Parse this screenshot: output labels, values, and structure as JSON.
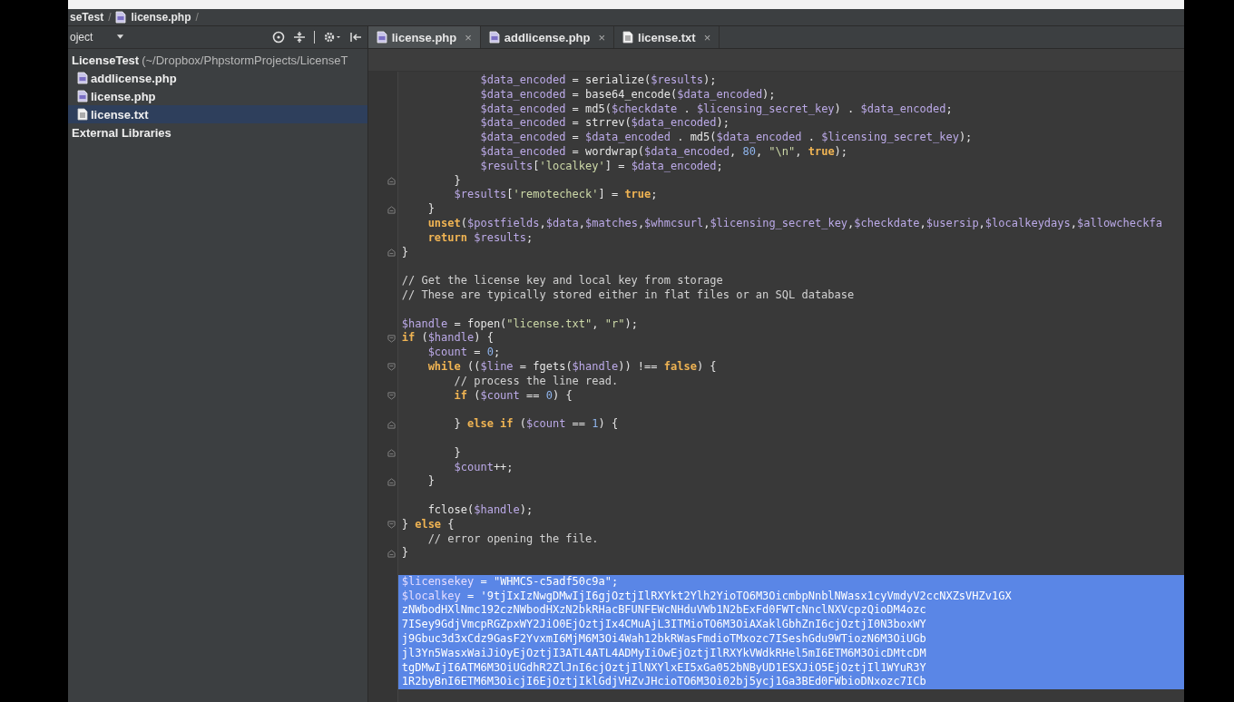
{
  "breadcrumb": [
    "seTest",
    "/",
    "license.php",
    "/"
  ],
  "project_panel": {
    "title": "oject",
    "tree": [
      {
        "name": "LicenseTest",
        "path": "(~/Dropbox/PhpstormProjects/LicenseT",
        "selected": false,
        "children": [
          {
            "name": "addlicense.php",
            "kind": "php",
            "selected": false
          },
          {
            "name": "license.php",
            "kind": "php",
            "selected": false
          },
          {
            "name": "license.txt",
            "kind": "txt",
            "selected": true
          }
        ]
      },
      {
        "name": "External Libraries",
        "selected": false
      }
    ]
  },
  "tabs": [
    {
      "label": "license.php",
      "kind": "php",
      "selected": true,
      "close": "×"
    },
    {
      "label": "addlicense.php",
      "kind": "php",
      "selected": false,
      "close": "×"
    },
    {
      "label": "license.txt",
      "kind": "txt",
      "selected": false,
      "close": "×"
    }
  ],
  "lines": [
    {
      "kind": "code",
      "selected": false,
      "parts": [
        {
          "kind": "var",
          "text": "            $data_encoded"
        },
        {
          "kind": "plain",
          "text": " = serialize("
        },
        {
          "kind": "var",
          "text": "$results"
        },
        {
          "kind": "plain",
          "text": ");"
        }
      ]
    },
    {
      "kind": "code",
      "selected": false,
      "parts": [
        {
          "kind": "var",
          "text": "            $data_encoded"
        },
        {
          "kind": "plain",
          "text": " = base64_encode("
        },
        {
          "kind": "var",
          "text": "$data_encoded"
        },
        {
          "kind": "plain",
          "text": ");"
        }
      ]
    },
    {
      "kind": "code",
      "selected": false,
      "parts": [
        {
          "kind": "var",
          "text": "            $data_encoded"
        },
        {
          "kind": "plain",
          "text": " = md5("
        },
        {
          "kind": "var",
          "text": "$checkdate"
        },
        {
          "kind": "plain",
          "text": " . "
        },
        {
          "kind": "var",
          "text": "$licensing_secret_key"
        },
        {
          "kind": "plain",
          "text": ") . "
        },
        {
          "kind": "var",
          "text": "$data_encoded"
        },
        {
          "kind": "plain",
          "text": ";"
        }
      ]
    },
    {
      "kind": "code",
      "selected": false,
      "parts": [
        {
          "kind": "var",
          "text": "            $data_encoded"
        },
        {
          "kind": "plain",
          "text": " = strrev("
        },
        {
          "kind": "var",
          "text": "$data_encoded"
        },
        {
          "kind": "plain",
          "text": ");"
        }
      ]
    },
    {
      "kind": "code",
      "selected": false,
      "parts": [
        {
          "kind": "var",
          "text": "            $data_encoded"
        },
        {
          "kind": "plain",
          "text": " = "
        },
        {
          "kind": "var",
          "text": "$data_encoded"
        },
        {
          "kind": "plain",
          "text": " . md5("
        },
        {
          "kind": "var",
          "text": "$data_encoded"
        },
        {
          "kind": "plain",
          "text": " . "
        },
        {
          "kind": "var",
          "text": "$licensing_secret_key"
        },
        {
          "kind": "plain",
          "text": ");"
        }
      ]
    },
    {
      "kind": "code",
      "selected": false,
      "parts": [
        {
          "kind": "var",
          "text": "            $data_encoded"
        },
        {
          "kind": "plain",
          "text": " = wordwrap("
        },
        {
          "kind": "var",
          "text": "$data_encoded"
        },
        {
          "kind": "plain",
          "text": ", "
        },
        {
          "kind": "num",
          "text": "80"
        },
        {
          "kind": "plain",
          "text": ", "
        },
        {
          "kind": "str",
          "text": "\"\\n\""
        },
        {
          "kind": "plain",
          "text": ", "
        },
        {
          "kind": "kw",
          "text": "true"
        },
        {
          "kind": "plain",
          "text": ");"
        }
      ]
    },
    {
      "kind": "code",
      "selected": false,
      "parts": [
        {
          "kind": "var",
          "text": "            $results"
        },
        {
          "kind": "plain",
          "text": "["
        },
        {
          "kind": "str",
          "text": "'localkey'"
        },
        {
          "kind": "plain",
          "text": "] = "
        },
        {
          "kind": "var",
          "text": "$data_encoded"
        },
        {
          "kind": "plain",
          "text": ";"
        }
      ]
    },
    {
      "kind": "fold-end",
      "selected": false,
      "parts": [
        {
          "kind": "plain",
          "text": "        }"
        }
      ]
    },
    {
      "kind": "code",
      "selected": false,
      "parts": [
        {
          "kind": "var",
          "text": "        $results"
        },
        {
          "kind": "plain",
          "text": "["
        },
        {
          "kind": "str",
          "text": "'remotecheck'"
        },
        {
          "kind": "plain",
          "text": "] = "
        },
        {
          "kind": "kw",
          "text": "true"
        },
        {
          "kind": "plain",
          "text": ";"
        }
      ]
    },
    {
      "kind": "fold-end",
      "selected": false,
      "parts": [
        {
          "kind": "plain",
          "text": "    }"
        }
      ]
    },
    {
      "kind": "code",
      "selected": false,
      "parts": [
        {
          "kind": "kw",
          "text": "    unset"
        },
        {
          "kind": "plain",
          "text": "("
        },
        {
          "kind": "var",
          "text": "$postfields"
        },
        {
          "kind": "plain",
          "text": ","
        },
        {
          "kind": "var",
          "text": "$data"
        },
        {
          "kind": "plain",
          "text": ","
        },
        {
          "kind": "var",
          "text": "$matches"
        },
        {
          "kind": "plain",
          "text": ","
        },
        {
          "kind": "var",
          "text": "$whmcsurl"
        },
        {
          "kind": "plain",
          "text": ","
        },
        {
          "kind": "var",
          "text": "$licensing_secret_key"
        },
        {
          "kind": "plain",
          "text": ","
        },
        {
          "kind": "var",
          "text": "$checkdate"
        },
        {
          "kind": "plain",
          "text": ","
        },
        {
          "kind": "var",
          "text": "$usersip"
        },
        {
          "kind": "plain",
          "text": ","
        },
        {
          "kind": "var",
          "text": "$localkeydays"
        },
        {
          "kind": "plain",
          "text": ","
        },
        {
          "kind": "var",
          "text": "$allowcheckfa"
        }
      ]
    },
    {
      "kind": "code",
      "selected": false,
      "parts": [
        {
          "kind": "kw",
          "text": "    return"
        },
        {
          "kind": "var",
          "text": " $results"
        },
        {
          "kind": "plain",
          "text": ";"
        }
      ]
    },
    {
      "kind": "fold-end",
      "selected": false,
      "parts": [
        {
          "kind": "plain",
          "text": "}"
        }
      ]
    },
    {
      "kind": "code",
      "selected": false
    },
    {
      "kind": "code",
      "selected": false,
      "parts": [
        {
          "kind": "com",
          "text": "// Get the license key and local key from storage"
        }
      ]
    },
    {
      "kind": "code",
      "selected": false,
      "parts": [
        {
          "kind": "com",
          "text": "// These are typically stored either in flat files or an SQL database"
        }
      ]
    },
    {
      "kind": "code",
      "selected": false
    },
    {
      "kind": "code",
      "selected": false,
      "parts": [
        {
          "kind": "var",
          "text": "$handle"
        },
        {
          "kind": "plain",
          "text": " = fopen("
        },
        {
          "kind": "str",
          "text": "\"license.txt\""
        },
        {
          "kind": "plain",
          "text": ", "
        },
        {
          "kind": "str",
          "text": "\"r\""
        },
        {
          "kind": "plain",
          "text": ");"
        }
      ]
    },
    {
      "kind": "fold-start",
      "selected": false,
      "parts": [
        {
          "kind": "kw",
          "text": "if"
        },
        {
          "kind": "plain",
          "text": " ("
        },
        {
          "kind": "var",
          "text": "$handle"
        },
        {
          "kind": "plain",
          "text": ") {"
        }
      ]
    },
    {
      "kind": "code",
      "selected": false,
      "parts": [
        {
          "kind": "var",
          "text": "    $count"
        },
        {
          "kind": "plain",
          "text": " = "
        },
        {
          "kind": "num",
          "text": "0"
        },
        {
          "kind": "plain",
          "text": ";"
        }
      ]
    },
    {
      "kind": "fold-start",
      "selected": false,
      "parts": [
        {
          "kind": "kw",
          "text": "    while"
        },
        {
          "kind": "plain",
          "text": " (("
        },
        {
          "kind": "var",
          "text": "$line"
        },
        {
          "kind": "plain",
          "text": " = fgets("
        },
        {
          "kind": "var",
          "text": "$handle"
        },
        {
          "kind": "plain",
          "text": ")) !== "
        },
        {
          "kind": "kw",
          "text": "false"
        },
        {
          "kind": "plain",
          "text": ") {"
        }
      ]
    },
    {
      "kind": "code",
      "selected": false,
      "parts": [
        {
          "kind": "com",
          "text": "        // process the line read."
        }
      ]
    },
    {
      "kind": "fold-start",
      "selected": false,
      "parts": [
        {
          "kind": "kw",
          "text": "        if"
        },
        {
          "kind": "plain",
          "text": " ("
        },
        {
          "kind": "var",
          "text": "$count"
        },
        {
          "kind": "plain",
          "text": " == "
        },
        {
          "kind": "num",
          "text": "0"
        },
        {
          "kind": "plain",
          "text": ") {"
        }
      ]
    },
    {
      "kind": "code",
      "selected": false
    },
    {
      "kind": "fold-end",
      "selected": false,
      "parts": [
        {
          "kind": "plain",
          "text": "        } "
        },
        {
          "kind": "kw",
          "text": "else if"
        },
        {
          "kind": "plain",
          "text": " ("
        },
        {
          "kind": "var",
          "text": "$count"
        },
        {
          "kind": "plain",
          "text": " == "
        },
        {
          "kind": "num",
          "text": "1"
        },
        {
          "kind": "plain",
          "text": ") {"
        }
      ]
    },
    {
      "kind": "code",
      "selected": false
    },
    {
      "kind": "fold-end",
      "selected": false,
      "parts": [
        {
          "kind": "plain",
          "text": "        }"
        }
      ]
    },
    {
      "kind": "code",
      "selected": false,
      "parts": [
        {
          "kind": "var",
          "text": "        $count"
        },
        {
          "kind": "plain",
          "text": "++;"
        }
      ]
    },
    {
      "kind": "fold-end",
      "selected": false,
      "parts": [
        {
          "kind": "plain",
          "text": "    }"
        }
      ]
    },
    {
      "kind": "code",
      "selected": false
    },
    {
      "kind": "code",
      "selected": false,
      "parts": [
        {
          "kind": "plain",
          "text": "    fclose("
        },
        {
          "kind": "var",
          "text": "$handle"
        },
        {
          "kind": "plain",
          "text": ");"
        }
      ]
    },
    {
      "kind": "fold-start",
      "selected": false,
      "parts": [
        {
          "kind": "plain",
          "text": "} "
        },
        {
          "kind": "kw",
          "text": "else"
        },
        {
          "kind": "plain",
          "text": " {"
        }
      ]
    },
    {
      "kind": "code",
      "selected": false,
      "parts": [
        {
          "kind": "com",
          "text": "    // error opening the file."
        }
      ]
    },
    {
      "kind": "fold-end",
      "selected": false,
      "parts": [
        {
          "kind": "plain",
          "text": "}"
        }
      ]
    },
    {
      "kind": "code",
      "selected": false
    },
    {
      "kind": "code",
      "selected": true,
      "parts": [
        {
          "kind": "var",
          "text": "$licensekey"
        },
        {
          "kind": "plain",
          "text": " = "
        },
        {
          "kind": "str",
          "text": "\"WHMCS-c5adf50c9a\""
        },
        {
          "kind": "plain",
          "text": ";"
        }
      ]
    },
    {
      "kind": "code",
      "selected": true,
      "parts": [
        {
          "kind": "var",
          "text": "$localkey"
        },
        {
          "kind": "plain",
          "text": " = "
        },
        {
          "kind": "str",
          "text": "'9tjIxIzNwgDMwIjI6gjOztjIlRXYkt2Ylh2YioTO6M3OicmbpNnblNWasx1cyVmdyV2ccNXZsVHZv1GX"
        }
      ]
    },
    {
      "kind": "code",
      "selected": true,
      "parts": [
        {
          "kind": "str",
          "text": "zNWbodHXlNmc192czNWbodHXzN2bkRHacBFUNFEWcNHduVWb1N2bExFd0FWTcNnclNXVcpzQioDM4ozc"
        }
      ]
    },
    {
      "kind": "code",
      "selected": true,
      "parts": [
        {
          "kind": "str",
          "text": "7ISey9GdjVmcpRGZpxWY2JiO0EjOztjIx4CMuAjL3ITMioTO6M3OiAXaklGbhZnI6cjOztjI0N3boxWY"
        }
      ]
    },
    {
      "kind": "code",
      "selected": true,
      "parts": [
        {
          "kind": "str",
          "text": "j9Gbuc3d3xCdz9GasF2YvxmI6MjM6M3Oi4Wah12bkRWasFmdioTMxozc7ISeshGdu9WTiozN6M3OiUGb"
        }
      ]
    },
    {
      "kind": "code",
      "selected": true,
      "parts": [
        {
          "kind": "str",
          "text": "jl3Yn5WasxWaiJiOyEjOztjI3ATL4ATL4ADMyIiOwEjOztjIlRXYkVWdkRHel5mI6ETM6M3OicDMtcDM"
        }
      ]
    },
    {
      "kind": "code",
      "selected": true,
      "parts": [
        {
          "kind": "str",
          "text": "tgDMwIjI6ATM6M3OiUGdhR2ZlJnI6cjOztjIlNXYlxEI5xGa052bNByUD1ESXJiO5EjOztjIl1WYuR3Y"
        }
      ]
    },
    {
      "kind": "code",
      "selected": true,
      "parts": [
        {
          "kind": "str",
          "text": "1R2byBnI6ETM6M3OicjI6EjOztjIklGdjVHZvJHcioTO6M3Oi02bj5ycj1Ga3BEd0FWbioDNxozc7ICb"
        }
      ]
    }
  ]
}
